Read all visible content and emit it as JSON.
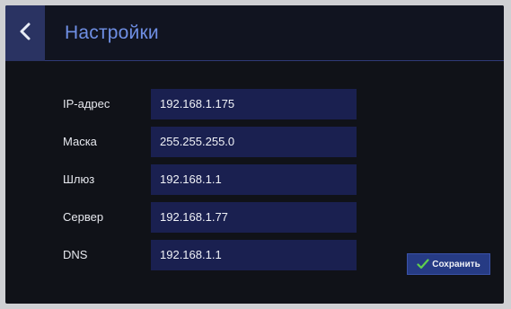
{
  "header": {
    "title": "Настройки",
    "back_icon": "chevron-left-icon"
  },
  "form": {
    "fields": [
      {
        "label": "IP-адрес",
        "value": "192.168.1.175"
      },
      {
        "label": "Маска",
        "value": "255.255.255.0"
      },
      {
        "label": "Шлюз",
        "value": "192.168.1.1"
      },
      {
        "label": "Сервер",
        "value": "192.168.1.77"
      },
      {
        "label": "DNS",
        "value": "192.168.1.1"
      }
    ]
  },
  "actions": {
    "save_label": "Сохранить",
    "save_icon": "checkmark-icon"
  },
  "colors": {
    "accent": "#6f8fe4",
    "field_bg": "#1a2050",
    "button_bg": "#263b84",
    "check": "#5fd04e"
  }
}
